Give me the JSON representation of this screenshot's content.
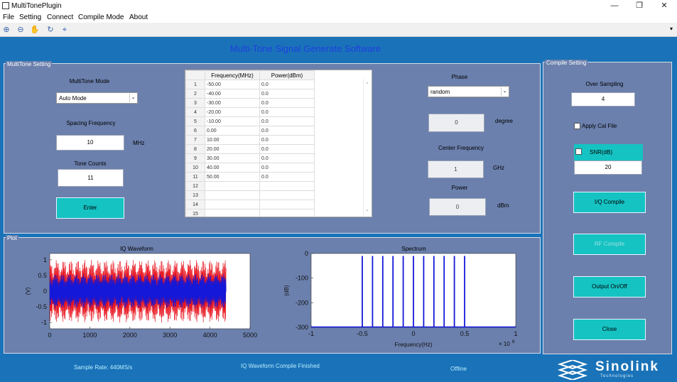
{
  "window": {
    "title": "MultiTonePlugin",
    "controls": [
      "—",
      "❐",
      "✕"
    ]
  },
  "menu": [
    "File",
    "Setting",
    "Connect",
    "Compile Mode",
    "About"
  ],
  "toolbar": [
    "zoom-in-icon",
    "zoom-out-icon",
    "pan-icon",
    "rotate-icon",
    "data-cursor-icon"
  ],
  "heading": "Multi-Tone Signal Generate Software",
  "multitone": {
    "title": "MultiTone Setting",
    "mode_label": "MultiTone Mode",
    "mode_value": "Auto Mode",
    "spacing_label": "Spacing Frequency",
    "spacing_value": "10",
    "spacing_unit": "MHz",
    "counts_label": "Tone Counts",
    "counts_value": "11",
    "enter_label": "Enter",
    "table": {
      "headers": [
        "Frequency(MHz)",
        "Power(dBm)"
      ],
      "rows": [
        [
          "1",
          "-50.00",
          "0.0"
        ],
        [
          "2",
          "-40.00",
          "0.0"
        ],
        [
          "3",
          "-30.00",
          "0.0"
        ],
        [
          "4",
          "-20.00",
          "0.0"
        ],
        [
          "5",
          "-10.00",
          "0.0"
        ],
        [
          "6",
          "0.00",
          "0.0"
        ],
        [
          "7",
          "10.00",
          "0.0"
        ],
        [
          "8",
          "20.00",
          "0.0"
        ],
        [
          "9",
          "30.00",
          "0.0"
        ],
        [
          "10",
          "40.00",
          "0.0"
        ],
        [
          "11",
          "50.00",
          "0.0"
        ],
        [
          "12",
          "",
          ""
        ],
        [
          "13",
          "",
          ""
        ],
        [
          "14",
          "",
          ""
        ],
        [
          "15",
          "",
          ""
        ]
      ]
    },
    "phase_label": "Phase",
    "phase_value": "random",
    "degree_value": "0",
    "degree_unit": "degree",
    "center_label": "Center Frequency",
    "center_value": "1",
    "center_unit": "GHz",
    "power_label": "Power",
    "power_value": "0",
    "power_unit": "dBm"
  },
  "compile": {
    "title": "Compile Setting",
    "oversampling_label": "Over Sampling",
    "oversampling_value": "4",
    "calfile_label": "Apply Cal File",
    "snr_label": "SNR(dB)",
    "snr_value": "20",
    "iq_button": "I/Q Compile",
    "rf_button": "RF Compile",
    "output_button": "Output On/Off",
    "close_button": "Close"
  },
  "plot": {
    "title": "Plot",
    "iq": {
      "title": "IQ Waveform",
      "ylabel": "(V)",
      "xticks": [
        "0",
        "1000",
        "2000",
        "3000",
        "4000",
        "5000"
      ],
      "yticks": [
        "1",
        "0.5",
        "0",
        "-0.5",
        "-1"
      ]
    },
    "spectrum": {
      "title": "Spectrum",
      "xlabel": "Frequency(Hz)",
      "ylabel": "(dB)",
      "exponent": "× 10",
      "exponent_power": "8",
      "xticks": [
        "-1",
        "-0.5",
        "0",
        "0.5",
        "1"
      ],
      "yticks": [
        "0",
        "-100",
        "-200",
        "-300"
      ]
    }
  },
  "chart_data": [
    {
      "type": "line",
      "title": "IQ Waveform",
      "ylabel": "(V)",
      "xlim": [
        0,
        5000
      ],
      "ylim": [
        -1.2,
        1.2
      ],
      "samples": 4400,
      "series": [
        {
          "color": "#e8121d",
          "amplitude": 1.0
        },
        {
          "color": "#1418d8",
          "amplitude": 0.55
        }
      ]
    },
    {
      "type": "bar",
      "title": "Spectrum",
      "xlabel": "Frequency(Hz)",
      "ylabel": "(dB)",
      "xlim": [
        -1,
        1
      ],
      "ylim": [
        -300,
        0
      ],
      "x_scale": 100000000,
      "x": [
        -0.5,
        -0.4,
        -0.3,
        -0.2,
        -0.1,
        0,
        0.1,
        0.2,
        0.3,
        0.4,
        0.5
      ],
      "values": [
        -10,
        -10,
        -10,
        -10,
        -10,
        -10,
        -10,
        -10,
        -10,
        -10,
        -10
      ],
      "floor": -300,
      "color": "#1418d8"
    }
  ],
  "status": {
    "sample_rate": "Sample Rate: 440MS/s",
    "message": "IQ Waveform Compile Finished",
    "connection": "Offline",
    "logo": "Sinolink",
    "logo_sub": "Technologies"
  }
}
